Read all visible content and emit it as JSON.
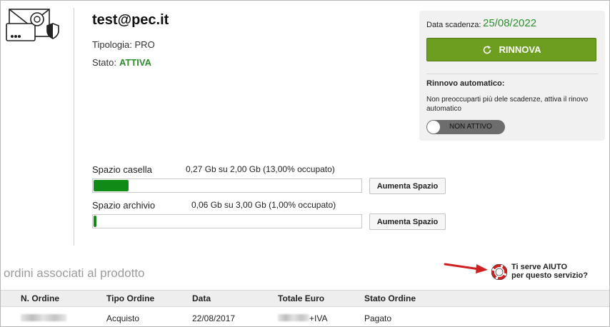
{
  "account": {
    "email": "test@pec.it",
    "tipologia_label": "Tipologia:",
    "tipologia_value": "PRO",
    "stato_label": "Stato:",
    "stato_value": "ATTIVA"
  },
  "renewal": {
    "expiry_label": "Data scadenza:",
    "expiry_value": "25/08/2022",
    "renew_button": "RINNOVA",
    "auto_renew_title": "Rinnovo automatico:",
    "auto_renew_desc": "Non preoccuparti più dele scadenze, attiva il rinovo automatico",
    "toggle_label": "NON ATTIVO",
    "toggle_on": false
  },
  "storage": {
    "mailbox_label": "Spazio casella",
    "mailbox_info": "0,27 Gb su 2,00 Gb (13,00% occupato)",
    "mailbox_fraction": 0.13,
    "archive_label": "Spazio archivio",
    "archive_info": "0,06 Gb su 3,00 Gb (1,00% occupato)",
    "archive_fraction": 0.01,
    "increase_button": "Aumenta Spazio"
  },
  "orders": {
    "title": "ordini associati al prodotto",
    "help_line1": "Ti serve AIUTO",
    "help_line2": "per questo servizio?",
    "columns": [
      "N. Ordine",
      "Tipo Ordine",
      "Data",
      "Totale Euro",
      "Stato Ordine"
    ],
    "rows": [
      {
        "tipo": "Acquisto",
        "data": "22/08/2017",
        "totale_suffix": "+IVA",
        "stato": "Pagato"
      }
    ]
  },
  "colors": {
    "accent_green": "#2e8b2e",
    "button_green": "#6e9e1f",
    "bar_green": "#118a18",
    "arrow_red": "#d01f1f"
  },
  "icons": {
    "logo": "pec-mail-envelope-icon",
    "renew": "refresh-icon",
    "help": "lifebuoy-icon",
    "pointer": "red-arrow-icon"
  }
}
